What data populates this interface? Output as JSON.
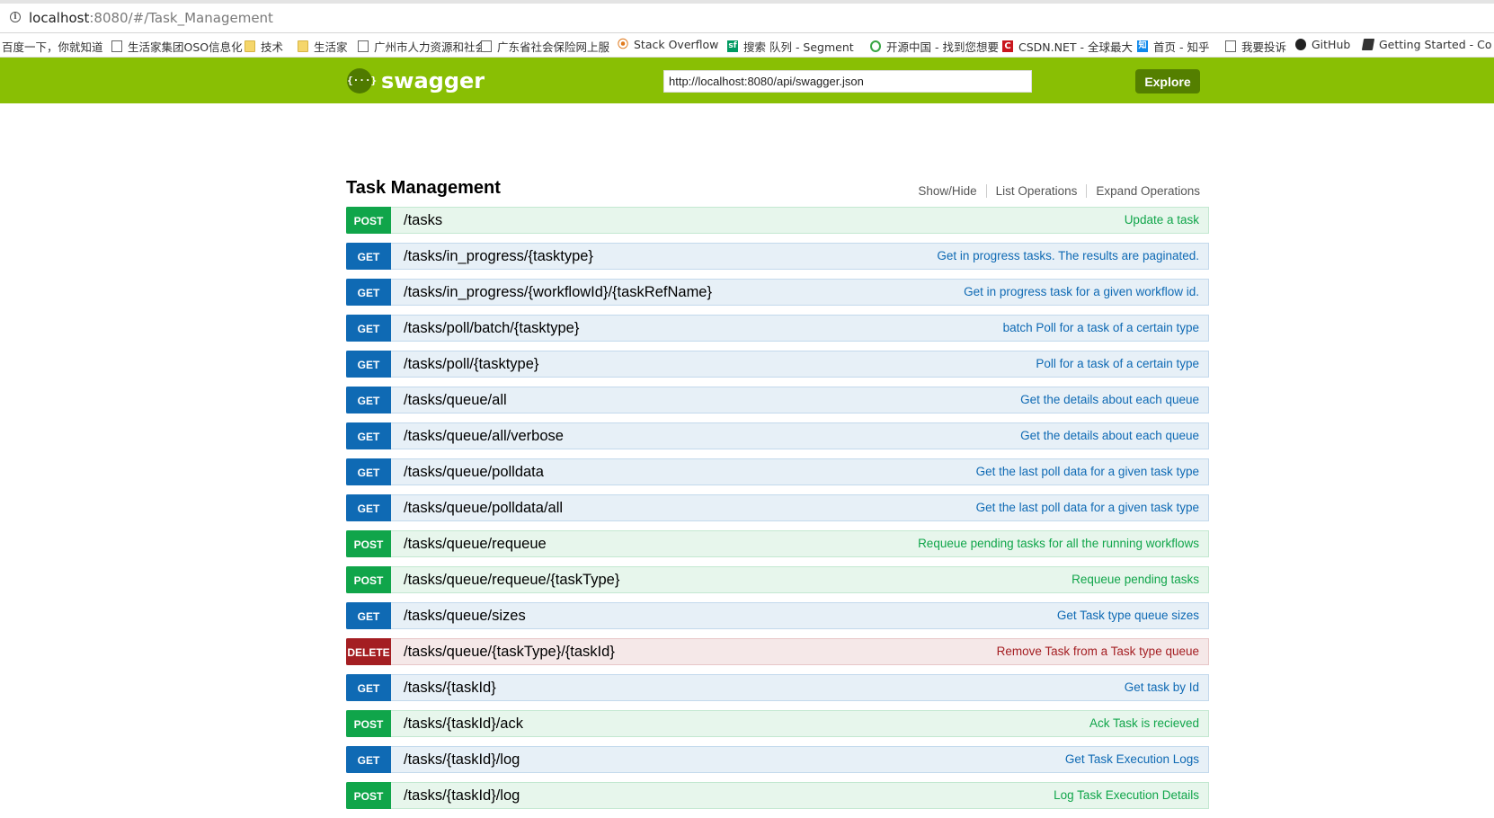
{
  "browser": {
    "url_host": "localhost",
    "url_rest": ":8080/#/Task_Management",
    "bookmarks": [
      {
        "label": "百度一下，你就知道",
        "icon": "none"
      },
      {
        "label": "生活家集团OSO信息化",
        "icon": "page-icon"
      },
      {
        "label": "技术",
        "icon": "folder-icon"
      },
      {
        "label": "生活家",
        "icon": "folder-icon"
      },
      {
        "label": "广州市人力资源和社会",
        "icon": "page-icon"
      },
      {
        "label": "广东省社会保险网上服",
        "icon": "page-icon"
      },
      {
        "label": "Stack Overflow",
        "icon": "stackoverflow-icon"
      },
      {
        "label": "搜索 队列 - Segment",
        "icon": "segmentfault-icon"
      },
      {
        "label": "开源中国 - 找到您想要",
        "icon": "oschina-icon"
      },
      {
        "label": "CSDN.NET - 全球最大",
        "icon": "csdn-icon"
      },
      {
        "label": "首页 - 知乎",
        "icon": "zhihu-icon"
      },
      {
        "label": "我要投诉",
        "icon": "page-icon"
      },
      {
        "label": "GitHub",
        "icon": "github-icon"
      },
      {
        "label": "Getting Started - Co",
        "icon": "book-icon"
      }
    ]
  },
  "header": {
    "logo_text": "swagger",
    "logo_glyph": "{···}",
    "spec_url": "http://localhost:8080/api/swagger.json",
    "explore_label": "Explore",
    "color": "#89bf04"
  },
  "resource": {
    "title": "Task Management",
    "links": {
      "show_hide": "Show/Hide",
      "list_operations": "List Operations",
      "expand_operations": "Expand Operations"
    }
  },
  "operations": [
    {
      "method": "POST",
      "path": "/tasks",
      "summary": "Update a task"
    },
    {
      "method": "GET",
      "path": "/tasks/in_progress/{tasktype}",
      "summary": "Get in progress tasks. The results are paginated."
    },
    {
      "method": "GET",
      "path": "/tasks/in_progress/{workflowId}/{taskRefName}",
      "summary": "Get in progress task for a given workflow id."
    },
    {
      "method": "GET",
      "path": "/tasks/poll/batch/{tasktype}",
      "summary": "batch Poll for a task of a certain type"
    },
    {
      "method": "GET",
      "path": "/tasks/poll/{tasktype}",
      "summary": "Poll for a task of a certain type"
    },
    {
      "method": "GET",
      "path": "/tasks/queue/all",
      "summary": "Get the details about each queue"
    },
    {
      "method": "GET",
      "path": "/tasks/queue/all/verbose",
      "summary": "Get the details about each queue"
    },
    {
      "method": "GET",
      "path": "/tasks/queue/polldata",
      "summary": "Get the last poll data for a given task type"
    },
    {
      "method": "GET",
      "path": "/tasks/queue/polldata/all",
      "summary": "Get the last poll data for a given task type"
    },
    {
      "method": "POST",
      "path": "/tasks/queue/requeue",
      "summary": "Requeue pending tasks for all the running workflows"
    },
    {
      "method": "POST",
      "path": "/tasks/queue/requeue/{taskType}",
      "summary": "Requeue pending tasks"
    },
    {
      "method": "GET",
      "path": "/tasks/queue/sizes",
      "summary": "Get Task type queue sizes"
    },
    {
      "method": "DELETE",
      "path": "/tasks/queue/{taskType}/{taskId}",
      "summary": "Remove Task from a Task type queue"
    },
    {
      "method": "GET",
      "path": "/tasks/{taskId}",
      "summary": "Get task by Id"
    },
    {
      "method": "POST",
      "path": "/tasks/{taskId}/ack",
      "summary": "Ack Task is recieved"
    },
    {
      "method": "GET",
      "path": "/tasks/{taskId}/log",
      "summary": "Get Task Execution Logs"
    },
    {
      "method": "POST",
      "path": "/tasks/{taskId}/log",
      "summary": "Log Task Execution Details"
    }
  ]
}
